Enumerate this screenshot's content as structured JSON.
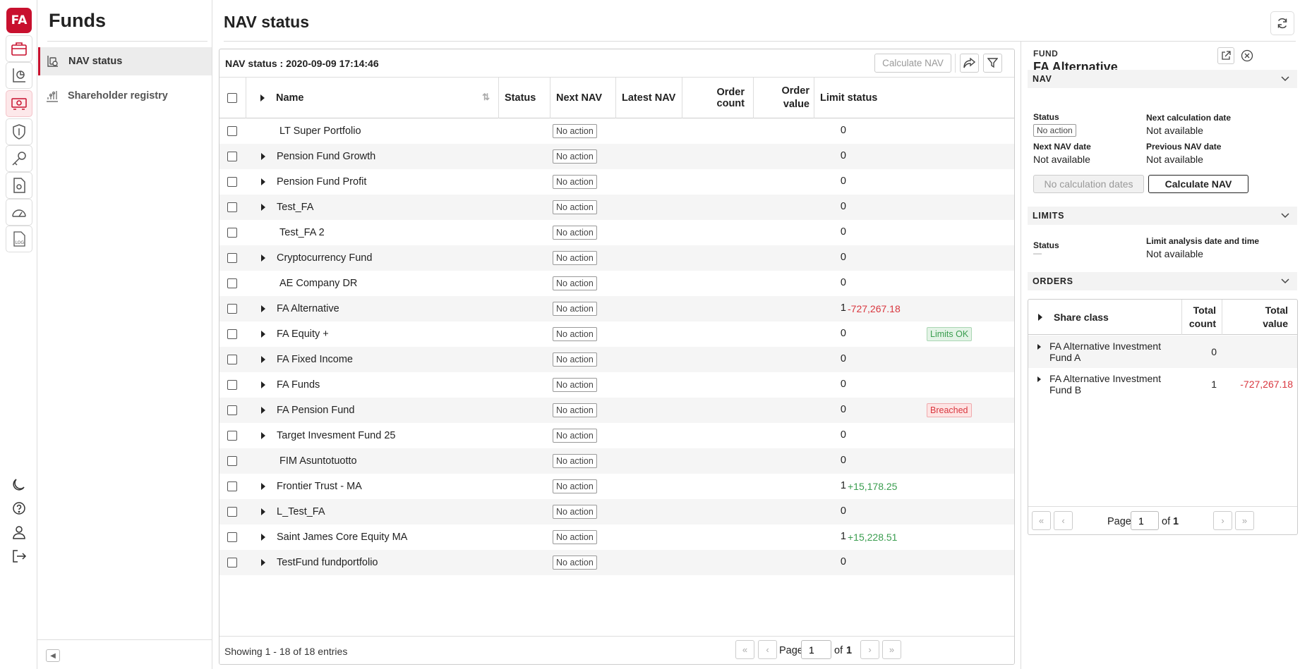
{
  "app": {
    "logo": "FA"
  },
  "section": {
    "title": "Funds"
  },
  "nav": [
    {
      "label": "NAV status",
      "icon": "nav-status-icon",
      "active": true
    },
    {
      "label": "Shareholder registry",
      "icon": "registry-chart-icon",
      "active": false
    }
  ],
  "rail": [
    {
      "icon": "briefcase-icon"
    },
    {
      "icon": "report-icon"
    },
    {
      "icon": "money-icon"
    },
    {
      "icon": "shield-icon"
    },
    {
      "icon": "key-icon"
    },
    {
      "icon": "document-icon"
    },
    {
      "icon": "gauge-icon"
    },
    {
      "icon": "log-icon"
    },
    {
      "icon": "moon-icon"
    },
    {
      "icon": "help-icon"
    },
    {
      "icon": "user-icon"
    },
    {
      "icon": "logout-icon"
    }
  ],
  "page": {
    "title": "NAV status"
  },
  "grid": {
    "title": "NAV status : 2020-09-09 17:14:46",
    "calc_button": "Calculate NAV",
    "columns": {
      "name": "Name",
      "status": "Status",
      "next_nav": "Next NAV",
      "latest_nav": "Latest NAV",
      "order_count": "Order count",
      "order_value": "Order value",
      "limit_status": "Limit status"
    },
    "rows": [
      {
        "name": "LT Super Portfolio",
        "expandable": false,
        "status": "No action",
        "count": "0",
        "value": "",
        "limit": ""
      },
      {
        "name": "Pension Fund Growth",
        "expandable": true,
        "status": "No action",
        "count": "0",
        "value": "",
        "limit": ""
      },
      {
        "name": "Pension Fund Profit",
        "expandable": true,
        "status": "No action",
        "count": "0",
        "value": "",
        "limit": ""
      },
      {
        "name": "Test_FA",
        "expandable": true,
        "status": "No action",
        "count": "0",
        "value": "",
        "limit": ""
      },
      {
        "name": "Test_FA 2",
        "expandable": false,
        "status": "No action",
        "count": "0",
        "value": "",
        "limit": ""
      },
      {
        "name": "Cryptocurrency Fund",
        "expandable": true,
        "status": "No action",
        "count": "0",
        "value": "",
        "limit": ""
      },
      {
        "name": "AE Company DR",
        "expandable": false,
        "status": "No action",
        "count": "0",
        "value": "",
        "limit": ""
      },
      {
        "name": "FA Alternative",
        "expandable": true,
        "status": "No action",
        "count": "1",
        "value": "-727,267.18",
        "limit": ""
      },
      {
        "name": "FA Equity +",
        "expandable": true,
        "status": "No action",
        "count": "0",
        "value": "",
        "limit": "Limits OK"
      },
      {
        "name": "FA Fixed Income",
        "expandable": true,
        "status": "No action",
        "count": "0",
        "value": "",
        "limit": ""
      },
      {
        "name": "FA Funds",
        "expandable": true,
        "status": "No action",
        "count": "0",
        "value": "",
        "limit": ""
      },
      {
        "name": "FA Pension Fund",
        "expandable": true,
        "status": "No action",
        "count": "0",
        "value": "",
        "limit": "Breached"
      },
      {
        "name": "Target Invesment Fund 25",
        "expandable": true,
        "status": "No action",
        "count": "0",
        "value": "",
        "limit": ""
      },
      {
        "name": "FIM Asuntotuotto",
        "expandable": false,
        "status": "No action",
        "count": "0",
        "value": "",
        "limit": ""
      },
      {
        "name": "Frontier Trust - MA",
        "expandable": true,
        "status": "No action",
        "count": "1",
        "value": "+15,178.25",
        "limit": ""
      },
      {
        "name": "L_Test_FA",
        "expandable": true,
        "status": "No action",
        "count": "0",
        "value": "",
        "limit": ""
      },
      {
        "name": "Saint James Core Equity MA",
        "expandable": true,
        "status": "No action",
        "count": "1",
        "value": "+15,228.51",
        "limit": ""
      },
      {
        "name": "TestFund fundportfolio",
        "expandable": true,
        "status": "No action",
        "count": "0",
        "value": "",
        "limit": ""
      }
    ],
    "footer": {
      "showing": "Showing 1 - 18 of 18 entries",
      "page_label": "Page",
      "page": "1",
      "of": "of",
      "total": "1"
    }
  },
  "detail": {
    "eyebrow": "FUND",
    "title": "FA Alternative",
    "nav_section": "NAV",
    "status_label": "Status",
    "status_value": "No action",
    "next_calc_label": "Next calculation date",
    "next_calc_value": "Not available",
    "next_nav_label": "Next NAV date",
    "next_nav_value": "Not available",
    "prev_nav_label": "Previous NAV date",
    "prev_nav_value": "Not available",
    "no_calc_dates": "No calculation dates",
    "calc_button": "Calculate NAV",
    "limits_section": "LIMITS",
    "limits_status_label": "Status",
    "limits_status_value": "—",
    "limit_date_label": "Limit analysis date and time",
    "limit_date_value": "Not available",
    "orders_section": "ORDERS",
    "orders": {
      "columns": {
        "share_class": "Share class",
        "total_count": "Total count",
        "total_value": "Total value"
      },
      "rows": [
        {
          "share_class": "FA Alternative Investment Fund A",
          "count": "0",
          "value": ""
        },
        {
          "share_class": "FA Alternative Investment Fund B",
          "count": "1",
          "value": "-727,267.18"
        }
      ],
      "footer": {
        "page_label": "Page",
        "page": "1",
        "of": "of",
        "total": "1"
      }
    }
  },
  "colors": {
    "brand": "#c8102e",
    "negative": "#d9363e",
    "positive": "#3a9d4f",
    "ok_bg": "#e3f3e6",
    "breach_bg": "#fde4e4"
  }
}
